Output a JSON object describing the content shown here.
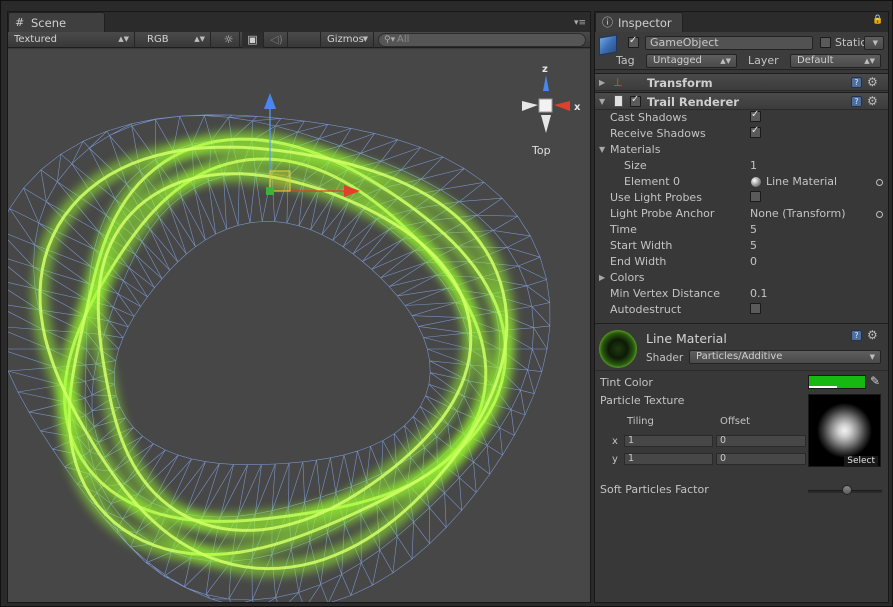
{
  "scene": {
    "tab_label": "Scene",
    "toolbar": {
      "shading_mode": "Textured",
      "render_mode": "RGB",
      "gizmos_label": "Gizmos",
      "search_placeholder": "All"
    },
    "orientation_label": "Top",
    "gizmo_axes": {
      "z": "z",
      "x": "x"
    }
  },
  "inspector": {
    "tab_label": "Inspector",
    "object_name": "GameObject",
    "static_label": "Static",
    "tag_label": "Tag",
    "tag_value": "Untagged",
    "layer_label": "Layer",
    "layer_value": "Default",
    "transform": {
      "title": "Transform"
    },
    "trail_renderer": {
      "title": "Trail Renderer",
      "fields": {
        "cast_shadows": {
          "label": "Cast Shadows",
          "checked": true
        },
        "receive_shadows": {
          "label": "Receive Shadows",
          "checked": true
        },
        "materials_label": "Materials",
        "size_label": "Size",
        "size_value": "1",
        "element0_label": "Element 0",
        "element0_value": "Line Material",
        "use_light_probes": {
          "label": "Use Light Probes",
          "checked": false
        },
        "light_probe_anchor_label": "Light Probe Anchor",
        "light_probe_anchor_value": "None (Transform)",
        "time_label": "Time",
        "time_value": "5",
        "start_width_label": "Start Width",
        "start_width_value": "5",
        "end_width_label": "End Width",
        "end_width_value": "0",
        "colors_label": "Colors",
        "min_vertex_label": "Min Vertex Distance",
        "min_vertex_value": "0.1",
        "autodestruct": {
          "label": "Autodestruct",
          "checked": false
        }
      }
    },
    "material": {
      "name": "Line Material",
      "shader_label": "Shader",
      "shader_value": "Particles/Additive",
      "tint_color_label": "Tint Color",
      "tint_color": "#17b811",
      "particle_texture_label": "Particle Texture",
      "tiling_label": "Tiling",
      "offset_label": "Offset",
      "x_label": "x",
      "y_label": "y",
      "tiling_x": "1",
      "tiling_y": "1",
      "offset_x": "0",
      "offset_y": "0",
      "select_label": "Select",
      "soft_particles_label": "Soft Particles Factor",
      "soft_particles_level": 0.5
    }
  },
  "colors": {
    "trail": "#9cff2e",
    "wireframe": "#8fb4ff",
    "axis_x": "#e0402a",
    "axis_y": "#5a9bff",
    "axis_z": "#3a7ce8"
  }
}
